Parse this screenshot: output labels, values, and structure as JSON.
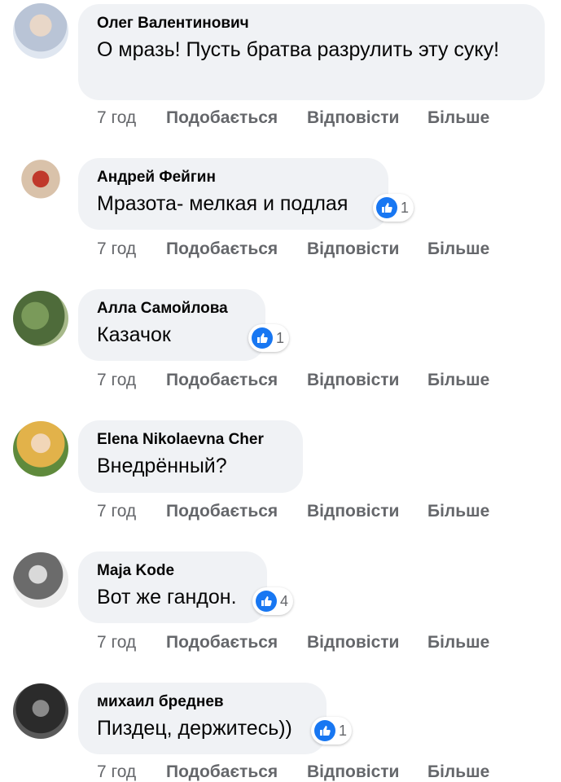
{
  "actions": {
    "like": "Подобається",
    "reply": "Відповісти",
    "more": "Більше"
  },
  "colors": {
    "bubble": "#f0f2f5",
    "text": "#050505",
    "secondary": "#65676b",
    "like_blue": "#1877f2"
  },
  "comments": [
    {
      "author": "Олег Валентинович",
      "text": "О мразь! Пусть братва разрулить эту суку!",
      "time": "7 год",
      "reactions": null,
      "avatar_icon": "user-avatar"
    },
    {
      "author": "Андрей Фейгин",
      "text": "Мразота- мелкая и подлая",
      "time": "7 год",
      "reactions": "1",
      "avatar_icon": "user-avatar"
    },
    {
      "author": "Алла Самойлова",
      "text": "Казачок",
      "time": "7 год",
      "reactions": "1",
      "avatar_icon": "user-avatar"
    },
    {
      "author": "Elena Nikolaevna Cher",
      "text": "Внедрённый?",
      "time": "7 год",
      "reactions": null,
      "avatar_icon": "user-avatar"
    },
    {
      "author": "Maja Kode",
      "text": "Вот же гандон.",
      "time": "7 год",
      "reactions": "4",
      "avatar_icon": "user-avatar"
    },
    {
      "author": "михаил бреднев",
      "text": "Пиздец, держитесь))",
      "time": "7 год",
      "reactions": "1",
      "avatar_icon": "user-avatar"
    }
  ]
}
